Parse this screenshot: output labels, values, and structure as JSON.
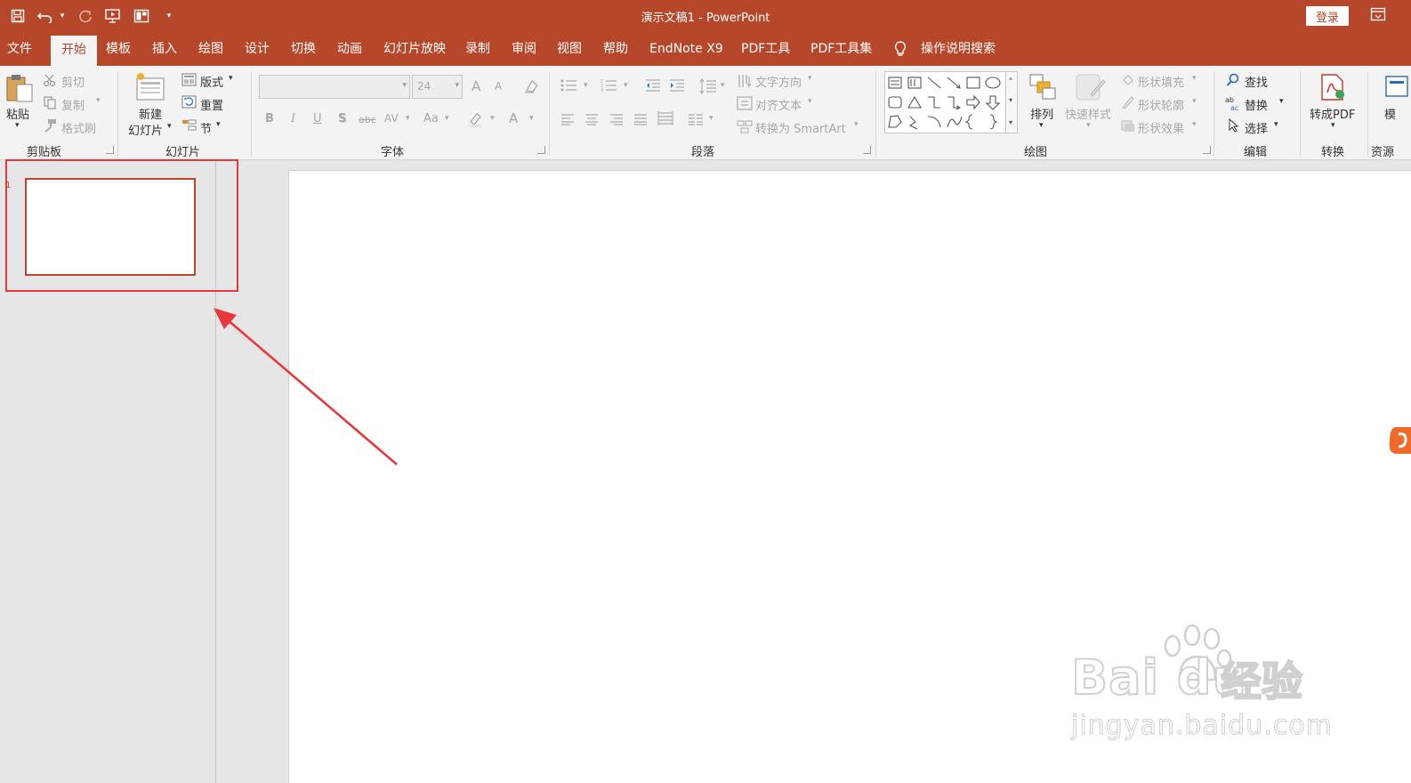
{
  "window": {
    "title": "演示文稿1  -  PowerPoint",
    "login_label": "登录"
  },
  "tabs": [
    {
      "label": "文件",
      "active": false
    },
    {
      "label": "开始",
      "active": true
    },
    {
      "label": "模板",
      "active": false
    },
    {
      "label": "插入",
      "active": false
    },
    {
      "label": "绘图",
      "active": false
    },
    {
      "label": "设计",
      "active": false
    },
    {
      "label": "切换",
      "active": false
    },
    {
      "label": "动画",
      "active": false
    },
    {
      "label": "幻灯片放映",
      "active": false
    },
    {
      "label": "录制",
      "active": false
    },
    {
      "label": "审阅",
      "active": false
    },
    {
      "label": "视图",
      "active": false
    },
    {
      "label": "帮助",
      "active": false
    },
    {
      "label": "EndNote X9",
      "active": false
    },
    {
      "label": "PDF工具",
      "active": false
    },
    {
      "label": "PDF工具集",
      "active": false
    },
    {
      "label": "操作说明搜索",
      "active": false
    }
  ],
  "ribbon": {
    "clipboard": {
      "label": "剪贴板",
      "paste": "粘贴",
      "cut": "剪切",
      "copy": "复制",
      "format_painter": "格式刷"
    },
    "slides": {
      "label": "幻灯片",
      "new_slide_line1": "新建",
      "new_slide_line2": "幻灯片",
      "layout": "版式",
      "reset": "重置",
      "section": "节"
    },
    "font": {
      "label": "字体",
      "font_name": "",
      "font_size": "24",
      "bold": "B",
      "italic": "I",
      "underline": "U",
      "shadow": "S",
      "strike": "abc",
      "spacing": "AV",
      "case": "Aa",
      "grow": "A",
      "shrink": "A",
      "color": "A"
    },
    "paragraph": {
      "label": "段落",
      "text_direction": "文字方向",
      "align_text": "对齐文本",
      "smartart": "转换为 SmartArt"
    },
    "drawing": {
      "label": "绘图",
      "arrange": "排列",
      "quick_styles": "快速样式",
      "shape_fill": "形状填充",
      "shape_outline": "形状轮廓",
      "shape_effects": "形状效果"
    },
    "editing": {
      "label": "编辑",
      "find": "查找",
      "replace": "替换",
      "select": "选择"
    },
    "convert": {
      "label": "转换",
      "to_pdf": "转成PDF"
    },
    "resources": {
      "label": "资源",
      "template": "模"
    }
  },
  "thumbnails": {
    "slide_number": "1"
  },
  "watermark": {
    "brand": "Bai du",
    "product": "经验",
    "url": "jingyan.baidu.com"
  },
  "colors": {
    "accent": "#b7472a",
    "annotation": "#e8383d"
  }
}
